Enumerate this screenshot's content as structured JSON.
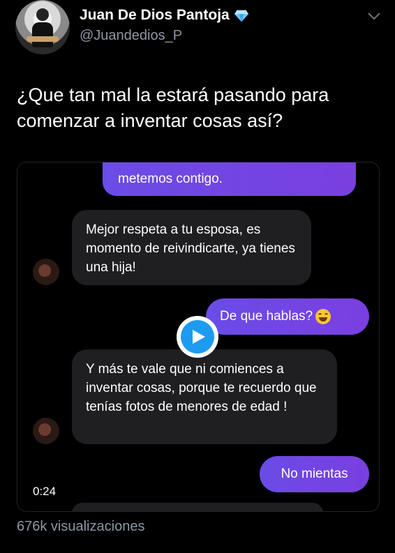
{
  "header": {
    "name": "Juan De Dios Pantoja",
    "handle": "@Juandedios_P"
  },
  "tweet": {
    "text": "¿Que tan mal la estará pasando para comenzar a inventar cosas así?"
  },
  "video": {
    "timestamp": "0:24",
    "messages": [
      {
        "side": "out",
        "text": "metemos contigo."
      },
      {
        "side": "in",
        "text": "Mejor respeta a tu esposa, es momento de reivindicarte, ya tienes una hija!"
      },
      {
        "side": "out",
        "text": "De que hablas?"
      },
      {
        "side": "in",
        "text": "Y más te vale que ni comiences a inventar cosas, porque te recuerdo que tenías fotos de menores de edad !"
      },
      {
        "side": "out",
        "text": "No mientas"
      }
    ]
  },
  "footer": {
    "views": "676k visualizaciones"
  },
  "colors": {
    "background": "#000000",
    "handle_gray": "#8b98a5",
    "play_blue": "#1d9bf0",
    "outgoing_bubble": "#5b63e8",
    "incoming_bubble": "#1f1f21"
  }
}
